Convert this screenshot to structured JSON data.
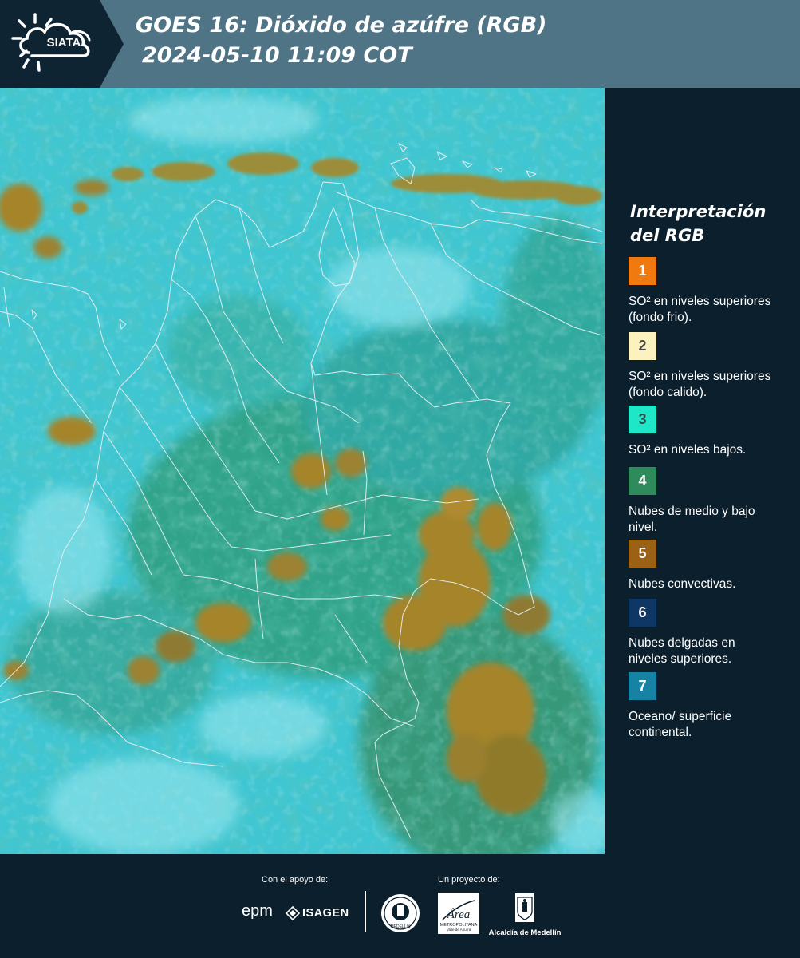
{
  "header": {
    "logo_text": "SIATA",
    "title": "GOES 16: Dióxido de azúfre (RGB)",
    "subtitle": "2024-05-10 11:09 COT",
    "colors": {
      "bar": "#4e7486",
      "logo_panel": "#0f2433"
    }
  },
  "map": {
    "description_icon": "satellite-rgb-map",
    "colors": {
      "surface": "#3fc6d2",
      "low_cloud": "#2fa39b",
      "mid_cloud": "#3f8f5e",
      "convective": "#a5842c",
      "borders": "#e6eef0"
    }
  },
  "legend": {
    "title": "Interpretación del RGB",
    "items": [
      {
        "number": "1",
        "label": "SO² en niveles superiores (fondo frio).",
        "color": "#f07a10",
        "text_color": "#ffffff"
      },
      {
        "number": "2",
        "label": "SO² en niveles superiores (fondo calido).",
        "color": "#fbf2bf",
        "text_color": "#4a4a4a"
      },
      {
        "number": "3",
        "label": "SO² en niveles bajos.",
        "color": "#1fe6c6",
        "text_color": "#2e4a4a"
      },
      {
        "number": "4",
        "label": "Nubes de medio y bajo nivel.",
        "color": "#2f8a5c",
        "text_color": "#ffffff"
      },
      {
        "number": "5",
        "label": "Nubes convectivas.",
        "color": "#9b6114",
        "text_color": "#ffffff"
      },
      {
        "number": "6",
        "label": "Nubes delgadas en niveles superiores.",
        "color": "#0f3766",
        "text_color": "#ffffff"
      },
      {
        "number": "7",
        "label": "Oceano/ superficie continental.",
        "color": "#1683a4",
        "text_color": "#ffffff"
      }
    ]
  },
  "footer": {
    "support_caption": "Con el apoyo de:",
    "project_caption": "Un proyecto de:",
    "epm_logo": "epm",
    "isagen_logo": "ISAGEN",
    "area_logo_text": "Área",
    "area_logo_subtext": "METROPOLITANA",
    "area_logo_tagline": "Valle de Aburrá",
    "alcaldia_text": "Alcaldía de Medellín",
    "seal_text": "MEDELLÍN"
  }
}
